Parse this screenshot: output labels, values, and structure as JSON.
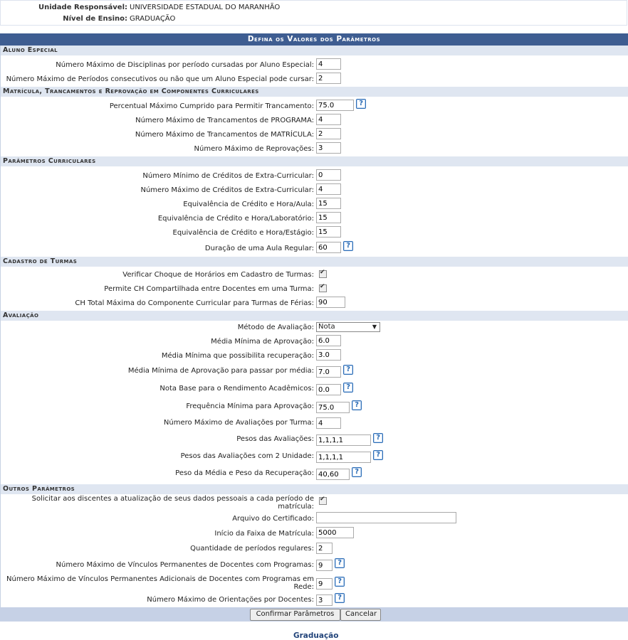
{
  "header": {
    "unidade_label": "Unidade Responsável:",
    "unidade_value": "UNIVERSIDADE ESTADUAL DO MARANHÃO",
    "nivel_label": "Nível de Ensino:",
    "nivel_value": "GRADUAÇÃO"
  },
  "form": {
    "caption": "Defina os Valores dos Parâmetros",
    "sections": {
      "aluno_especial": "Aluno Especial",
      "matricula": "Matrícula, Trancamentos e Reprovação em Componentes Curriculares",
      "curriculares": "Parâmetros Curriculares",
      "turmas": "Cadastro de Turmas",
      "avaliacao": "Avaliação",
      "outros": "Outros Parâmetros"
    },
    "fields": {
      "max_disc_especial": {
        "label": "Número Máximo de Disciplinas por período cursadas por Aluno Especial:",
        "value": "4"
      },
      "max_periodos_especial": {
        "label": "Número Máximo de Períodos consecutivos ou não que um Aluno Especial pode cursar:",
        "value": "2"
      },
      "percentual_trancamento": {
        "label": "Percentual Máximo Cumprido para Permitir Trancamento:",
        "value": "75.0"
      },
      "max_tranc_programa": {
        "label": "Número Máximo de Trancamentos de PROGRAMA:",
        "value": "4"
      },
      "max_tranc_matricula": {
        "label": "Número Máximo de Trancamentos de MATRÍCULA:",
        "value": "2"
      },
      "max_reprovacoes": {
        "label": "Número Máximo de Reprovações:",
        "value": "3"
      },
      "min_creditos_extra": {
        "label": "Número Mínimo de Créditos de Extra-Curricular:",
        "value": "0"
      },
      "max_creditos_extra": {
        "label": "Número Máximo de Créditos de Extra-Curricular:",
        "value": "4"
      },
      "equiv_aula": {
        "label": "Equivalência de Crédito e Hora/Aula:",
        "value": "15"
      },
      "equiv_laboratorio": {
        "label": "Equivalência de Crédito e Hora/Laboratório:",
        "value": "15"
      },
      "equiv_estagio": {
        "label": "Equivalência de Crédito e Hora/Estágio:",
        "value": "15"
      },
      "duracao_aula": {
        "label": "Duração de uma Aula Regular:",
        "value": "60"
      },
      "choque_horarios": {
        "label": "Verificar Choque de Horários em Cadastro de Turmas:",
        "checked": true
      },
      "ch_compartilhada": {
        "label": "Permite CH Compartilhada entre Docentes em uma Turma:",
        "checked": true
      },
      "ch_ferias": {
        "label": "CH Total Máxima do Componente Curricular para Turmas de Férias:",
        "value": "90"
      },
      "metodo_avaliacao": {
        "label": "Método de Avaliação:",
        "value": "Nota"
      },
      "media_aprovacao": {
        "label": "Média Mínima de Aprovação:",
        "value": "6.0"
      },
      "media_recuperacao": {
        "label": "Média Mínima que possibilita recuperação:",
        "value": "3.0"
      },
      "media_por_media": {
        "label": "Média Mínima de Aprovação para passar por média:",
        "value": "7.0"
      },
      "nota_base": {
        "label": "Nota Base para o Rendimento Acadêmicos:",
        "value": "0.0"
      },
      "frequencia_minima": {
        "label": "Frequência Mínima para Aprovação:",
        "value": "75.0"
      },
      "max_avaliacoes": {
        "label": "Número Máximo de Avaliações por Turma:",
        "value": "4"
      },
      "pesos_avaliacoes": {
        "label": "Pesos das Avaliações:",
        "value": "1,1,1,1"
      },
      "pesos_2_unidade": {
        "label": "Pesos das Avaliações com 2 Unidade:",
        "value": "1,1,1,1"
      },
      "peso_media_recuperacao": {
        "label": "Peso da Média e Peso da Recuperação:",
        "value": "40,60"
      },
      "atualizacao_dados_l1": "Solicitar aos discentes a atualização de seus dados pessoais a cada período de",
      "atualizacao_dados_l2": "matrícula:",
      "arquivo_certificado": {
        "label": "Arquivo do Certificado:",
        "value": ""
      },
      "inicio_faixa": {
        "label": "Início da Faixa de Matrícula:",
        "value": "5000"
      },
      "periodos_regulares": {
        "label": "Quantidade de períodos regulares:",
        "value": "2"
      },
      "vinculos_docentes": {
        "label": "Número Máximo de Vínculos Permanentes de Docentes com Programas:",
        "value": "9"
      },
      "vinculos_rede_l1": "Número Máximo de Vínculos Permanentes Adicionais de Docentes com Programas em",
      "vinculos_rede_l2": "Rede:",
      "vinculos_rede_value": "9",
      "orientacoes": {
        "label": "Número Máximo de Orientações por Docentes:",
        "value": "3"
      }
    },
    "help_glyph": "?",
    "select_arrow": "▼"
  },
  "buttons": {
    "confirm": "Confirmar Parâmetros",
    "cancel": "Cancelar"
  },
  "footer_link": "Graduação"
}
